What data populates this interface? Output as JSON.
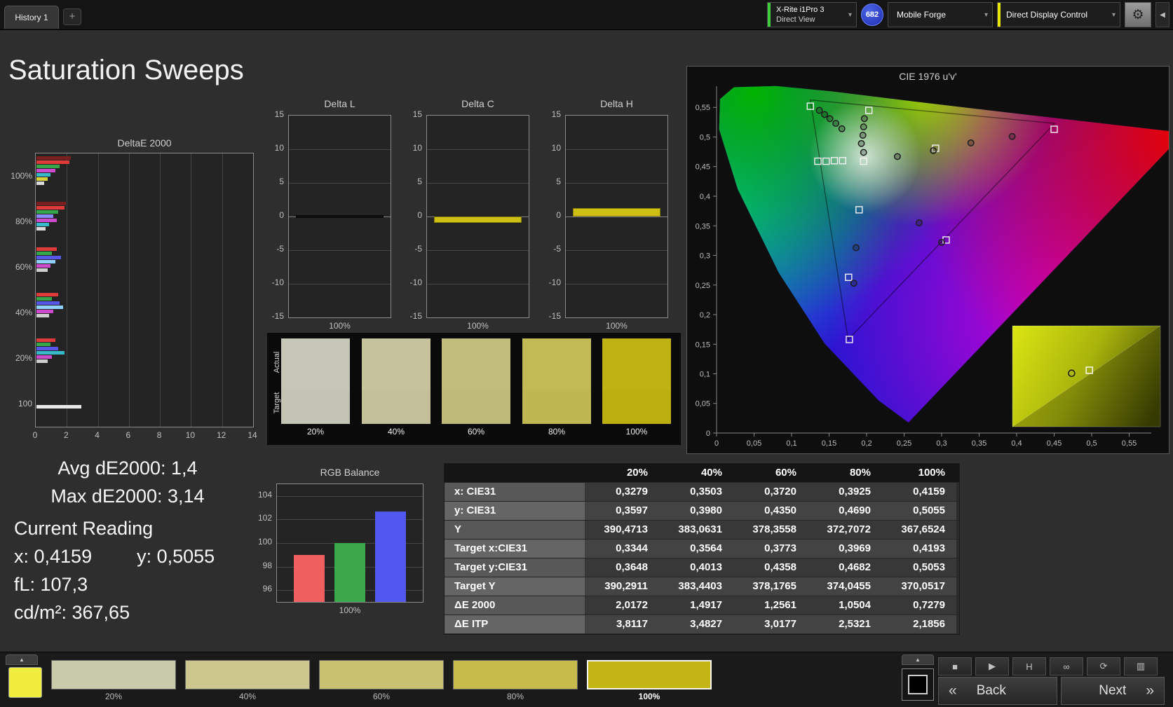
{
  "page_title": "Saturation Sweeps",
  "top_bar": {
    "history_tab": "History 1",
    "add_tab": "+",
    "meter_line1": "X-Rite i1Pro 3",
    "meter_line2": "Direct View",
    "meter_indicator_color": "#3ecc3e",
    "badge": "682",
    "source_label": "Mobile Forge",
    "display_label": "Direct Display Control",
    "display_indicator_color": "#e6e600",
    "gear_icon": "⚙",
    "collapse_icon": "◀",
    "chevron_icon": "▾"
  },
  "readings": {
    "avg": "Avg dE2000: 1,4",
    "max": "Max dE2000: 3,14",
    "current_heading": "Current Reading",
    "x": "x: 0,4159",
    "y": "y: 0,5055",
    "fl": "fL: 107,3",
    "cd": "cd/m²: 367,65"
  },
  "saturation_swatches": {
    "row_label_top": "Actual",
    "row_label_bottom": "Target",
    "items": [
      {
        "label": "20%",
        "actual": "#c6c7b6",
        "target": "#c3c4b3"
      },
      {
        "label": "40%",
        "actual": "#c6c39c",
        "target": "#c3c099"
      },
      {
        "label": "60%",
        "actual": "#c3bd7d",
        "target": "#c0ba7a"
      },
      {
        "label": "80%",
        "actual": "#c2ba55",
        "target": "#bfb752"
      },
      {
        "label": "100%",
        "actual": "#c0b214",
        "target": "#bdaf11"
      }
    ]
  },
  "table": {
    "headers": [
      "20%",
      "40%",
      "60%",
      "80%",
      "100%"
    ],
    "rows": [
      {
        "label": "x: CIE31",
        "values": [
          "0,3279",
          "0,3503",
          "0,3720",
          "0,3925",
          "0,4159"
        ]
      },
      {
        "label": "y: CIE31",
        "values": [
          "0,3597",
          "0,3980",
          "0,4350",
          "0,4690",
          "0,5055"
        ]
      },
      {
        "label": "Y",
        "values": [
          "390,4713",
          "383,0631",
          "378,3558",
          "372,7072",
          "367,6524"
        ]
      },
      {
        "label": "Target x:CIE31",
        "values": [
          "0,3344",
          "0,3564",
          "0,3773",
          "0,3969",
          "0,4193"
        ]
      },
      {
        "label": "Target y:CIE31",
        "values": [
          "0,3648",
          "0,4013",
          "0,4358",
          "0,4682",
          "0,5053"
        ]
      },
      {
        "label": "Target Y",
        "values": [
          "390,2911",
          "383,4403",
          "378,1765",
          "374,0455",
          "370,0517"
        ]
      },
      {
        "label": "ΔE 2000",
        "values": [
          "2,0172",
          "1,4917",
          "1,2561",
          "1,0504",
          "0,7279"
        ]
      },
      {
        "label": "ΔE ITP",
        "values": [
          "3,8117",
          "3,4827",
          "3,0177",
          "2,5321",
          "2,1856"
        ]
      }
    ]
  },
  "bottom_bar": {
    "up_arrow": "▲",
    "back_label": "Back",
    "next_label": "Next",
    "back_chevron": "«",
    "next_chevron": "»",
    "yellow_button_color": "#f1ed3e",
    "icons": [
      {
        "name": "stop-icon",
        "glyph": "■"
      },
      {
        "name": "play-icon",
        "glyph": "▶"
      },
      {
        "name": "hold-icon",
        "glyph": "H"
      },
      {
        "name": "continuous-measure-icon",
        "glyph": "∞"
      },
      {
        "name": "refresh-icon",
        "glyph": "⟳"
      },
      {
        "name": "pattern-window-icon",
        "glyph": "▥"
      }
    ],
    "swatches": [
      {
        "label": "20%",
        "color": "#c9c9ab",
        "selected": false
      },
      {
        "label": "40%",
        "color": "#cbc78d",
        "selected": false
      },
      {
        "label": "60%",
        "color": "#c9c170",
        "selected": false
      },
      {
        "label": "80%",
        "color": "#c6bb4b",
        "selected": false
      },
      {
        "label": "100%",
        "color": "#c4b414",
        "selected": true
      }
    ]
  },
  "chart_data": {
    "deltae2000": {
      "type": "bar",
      "orientation": "horizontal",
      "title": "DeltaE 2000",
      "xlim": [
        0,
        14
      ],
      "x_ticks": [
        "0",
        "2",
        "4",
        "6",
        "8",
        "10",
        "12",
        "14"
      ],
      "groups": [
        {
          "label": "100%",
          "bars": [
            {
              "color": "#7a1f1f",
              "value": 2.2
            },
            {
              "color": "#e03a3a",
              "value": 2.1
            },
            {
              "color": "#35a64a",
              "value": 1.5
            },
            {
              "color": "#cf49cf",
              "value": 1.2
            },
            {
              "color": "#38b9c9",
              "value": 0.9
            },
            {
              "color": "#d6d23a",
              "value": 0.7
            },
            {
              "color": "#d9d9d9",
              "value": 0.5
            }
          ]
        },
        {
          "label": "80%",
          "bars": [
            {
              "color": "#7a1f1f",
              "value": 1.9
            },
            {
              "color": "#e03a3a",
              "value": 1.8
            },
            {
              "color": "#35a64a",
              "value": 1.4
            },
            {
              "color": "#8a8aff",
              "value": 1.1
            },
            {
              "color": "#cf49cf",
              "value": 1.3
            },
            {
              "color": "#38b9c9",
              "value": 0.8
            },
            {
              "color": "#d9d9d9",
              "value": 0.6
            }
          ]
        },
        {
          "label": "60%",
          "bars": [
            {
              "color": "#e03a3a",
              "value": 1.3
            },
            {
              "color": "#35a64a",
              "value": 1.0
            },
            {
              "color": "#5656e8",
              "value": 1.6
            },
            {
              "color": "#8fd0ff",
              "value": 1.2
            },
            {
              "color": "#cf49cf",
              "value": 0.9
            },
            {
              "color": "#cfcfcf",
              "value": 0.7
            }
          ]
        },
        {
          "label": "40%",
          "bars": [
            {
              "color": "#e03a3a",
              "value": 1.4
            },
            {
              "color": "#35a64a",
              "value": 1.0
            },
            {
              "color": "#5656e8",
              "value": 1.5
            },
            {
              "color": "#8fd0ff",
              "value": 1.7
            },
            {
              "color": "#cf49cf",
              "value": 1.1
            },
            {
              "color": "#cfcfcf",
              "value": 0.8
            }
          ]
        },
        {
          "label": "20%",
          "bars": [
            {
              "color": "#e03a3a",
              "value": 1.2
            },
            {
              "color": "#35a64a",
              "value": 0.9
            },
            {
              "color": "#5656e8",
              "value": 1.4
            },
            {
              "color": "#38b9c9",
              "value": 1.8
            },
            {
              "color": "#cf49cf",
              "value": 1.0
            },
            {
              "color": "#cfcfcf",
              "value": 0.7
            }
          ]
        },
        {
          "label": "100",
          "bars": [
            {
              "color": "#e8e8e8",
              "value": 2.9
            }
          ]
        }
      ]
    },
    "delta_l": {
      "type": "bar",
      "title": "Delta L",
      "ylim": [
        -15,
        15
      ],
      "y_ticks": [
        "15",
        "10",
        "5",
        "0",
        "-5",
        "-10",
        "-15"
      ],
      "categories": [
        "100%"
      ],
      "values": [
        0.1
      ],
      "bar_color": "#101010",
      "xlabel": "100%"
    },
    "delta_c": {
      "type": "bar",
      "title": "Delta C",
      "ylim": [
        -15,
        15
      ],
      "y_ticks": [
        "15",
        "10",
        "5",
        "0",
        "-5",
        "-10",
        "-15"
      ],
      "categories": [
        "100%"
      ],
      "values": [
        -0.9
      ],
      "bar_color": "#cdc013",
      "xlabel": "100%"
    },
    "delta_h": {
      "type": "bar",
      "title": "Delta H",
      "ylim": [
        -15,
        15
      ],
      "y_ticks": [
        "15",
        "10",
        "5",
        "0",
        "-5",
        "-10",
        "-15"
      ],
      "categories": [
        "100%"
      ],
      "values": [
        1.3
      ],
      "bar_color": "#cdc013",
      "xlabel": "100%"
    },
    "rgb_balance": {
      "type": "bar",
      "title": "RGB Balance",
      "ylim": [
        95,
        105
      ],
      "y_ticks": [
        "104",
        "102",
        "100",
        "98",
        "96"
      ],
      "categories": [
        "Red",
        "Green",
        "Blue"
      ],
      "values": [
        99,
        100,
        102.7
      ],
      "colors": [
        "#ef5f5f",
        "#3aa84b",
        "#5257f2"
      ],
      "xlabel": "100%"
    },
    "cie": {
      "type": "scatter",
      "title": "CIE 1976 u'v'",
      "x_ticks": [
        "0",
        "0,05",
        "0,1",
        "0,15",
        "0,2",
        "0,25",
        "0,3",
        "0,35",
        "0,4",
        "0,45",
        "0,5",
        "0,55"
      ],
      "y_ticks": [
        "0,55",
        "0,5",
        "0,45",
        "0,4",
        "0,35",
        "0,3",
        "0,25",
        "0,2",
        "0,15",
        "0,1",
        "0,05",
        "0"
      ],
      "targets": [
        [
          0.125,
          0.552
        ],
        [
          0.203,
          0.545
        ],
        [
          0.196,
          0.459
        ],
        [
          0.135,
          0.459
        ],
        [
          0.146,
          0.459
        ],
        [
          0.157,
          0.46
        ],
        [
          0.168,
          0.46
        ],
        [
          0.292,
          0.481
        ],
        [
          0.45,
          0.513
        ],
        [
          0.19,
          0.377
        ],
        [
          0.306,
          0.326
        ],
        [
          0.176,
          0.263
        ],
        [
          0.177,
          0.158
        ]
      ],
      "measured": [
        [
          0.137,
          0.545
        ],
        [
          0.144,
          0.538
        ],
        [
          0.151,
          0.531
        ],
        [
          0.159,
          0.523
        ],
        [
          0.167,
          0.514
        ],
        [
          0.197,
          0.531
        ],
        [
          0.196,
          0.517
        ],
        [
          0.195,
          0.503
        ],
        [
          0.193,
          0.489
        ],
        [
          0.196,
          0.474
        ],
        [
          0.241,
          0.467
        ],
        [
          0.289,
          0.477
        ],
        [
          0.339,
          0.49
        ],
        [
          0.394,
          0.501
        ],
        [
          0.27,
          0.355
        ],
        [
          0.3,
          0.322
        ],
        [
          0.186,
          0.313
        ],
        [
          0.183,
          0.253
        ]
      ],
      "inset": {
        "circle": [
          0.4,
          0.47
        ],
        "square": [
          0.52,
          0.44
        ]
      }
    }
  }
}
